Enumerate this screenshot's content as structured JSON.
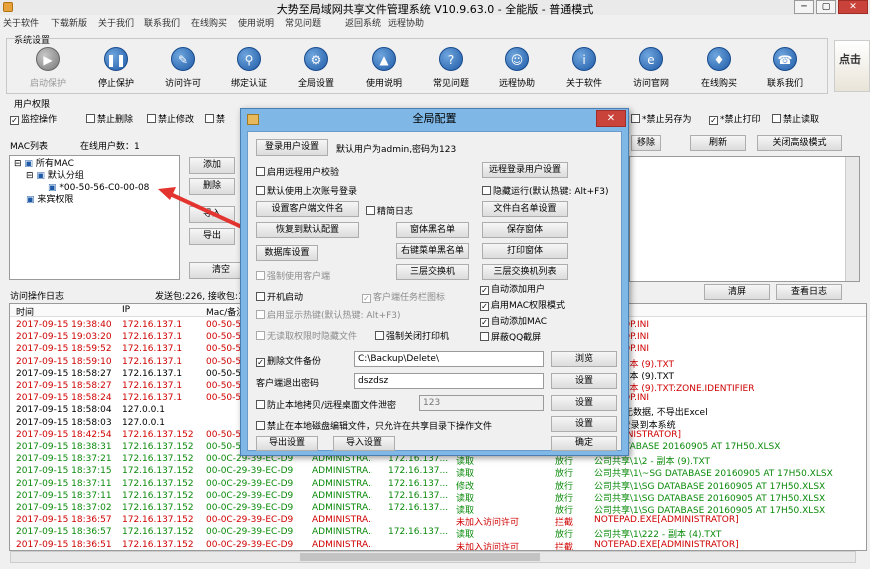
{
  "window": {
    "title": "大势至局域网共享文件管理系统 V10.9.63.0 - 全能版 - 普通模式",
    "min": "─",
    "max": "▢",
    "close": "✕"
  },
  "menu": [
    "关于软件",
    "下载新版",
    "关于我们",
    "联系我们",
    "在线购买",
    "使用说明",
    "常见问题",
    "返回系统",
    "远程协助"
  ],
  "system_settings": {
    "label": "系统设置",
    "buttons": [
      {
        "label": "启动保护",
        "icon": "play-icon",
        "glyph": "▶",
        "disabled": true
      },
      {
        "label": "停止保护",
        "icon": "pause-icon",
        "glyph": "❚❚",
        "disabled": false
      },
      {
        "label": "访问许可",
        "icon": "compass-icon",
        "glyph": "✎",
        "disabled": false
      },
      {
        "label": "绑定认证",
        "icon": "link-icon",
        "glyph": "⚲",
        "disabled": false
      },
      {
        "label": "全局设置",
        "icon": "gear-icon",
        "glyph": "⚙",
        "disabled": false
      },
      {
        "label": "使用说明",
        "icon": "graduation-cap-icon",
        "glyph": "▲",
        "disabled": false
      },
      {
        "label": "常见问题",
        "icon": "question-icon",
        "glyph": "?",
        "disabled": false
      },
      {
        "label": "远程协助",
        "icon": "support-icon",
        "glyph": "☺",
        "disabled": false
      },
      {
        "label": "关于软件",
        "icon": "info-icon",
        "glyph": "i",
        "disabled": false
      },
      {
        "label": "访问官网",
        "icon": "browser-icon",
        "glyph": "e",
        "disabled": false
      },
      {
        "label": "在线购买",
        "icon": "cart-icon",
        "glyph": "♦",
        "disabled": false
      },
      {
        "label": "联系我们",
        "icon": "phone-icon",
        "glyph": "☎",
        "disabled": false
      }
    ],
    "logo_text": "点击"
  },
  "user_permissions": {
    "label": "用户权限",
    "checks": [
      {
        "label": "监控操作",
        "checked": true
      },
      {
        "label": "禁止删除",
        "checked": false
      },
      {
        "label": "禁止修改",
        "checked": false
      },
      {
        "label": "禁",
        "checked": false
      },
      {
        "label": "*禁止另存为",
        "checked": false
      },
      {
        "label": "*禁止打印",
        "checked": true
      },
      {
        "label": "禁止读取",
        "checked": false
      }
    ]
  },
  "mac_list": {
    "label": "MAC列表",
    "online_users": "在线用户数：1",
    "tree": [
      "所有MAC",
      "默认分组",
      "*00-50-56-C0-00-08",
      "来宾权限"
    ],
    "side_buttons": [
      "添加",
      "删除",
      "导入",
      "导出",
      "清空"
    ],
    "top_right_buttons": [
      "移除",
      "刷新",
      "关闭高级模式"
    ]
  },
  "access_log": {
    "label": "访问操作日志",
    "stats": "发送包:226, 接收包:1",
    "clear_button": "清屏",
    "view_log_button": "查看日志",
    "columns": [
      "时间",
      "IP",
      "Mac/备注"
    ],
    "rows": [
      {
        "color": "red",
        "time": "2017-09-15 19:38:40",
        "ip": "172.16.137.1",
        "mac": "00-50-56",
        "tail": "DESKTOP.INI"
      },
      {
        "color": "red",
        "time": "2017-09-15 19:03:20",
        "ip": "172.16.137.1",
        "mac": "00-50-56",
        "tail": "DESKTOP.INI"
      },
      {
        "color": "red",
        "time": "2017-09-15 18:59:52",
        "ip": "172.16.137.1",
        "mac": "00-50-56",
        "tail": "DESKTOP.INI"
      },
      {
        "color": "red",
        "time": "2017-09-15 18:59:10",
        "ip": "172.16.137.1",
        "mac": "00-50-56",
        "tail": "\\1\\2 - 副本 (9).TXT"
      },
      {
        "color": "black",
        "time": "2017-09-15 18:58:27",
        "ip": "172.16.137.1",
        "mac": "00-50-56",
        "tail": "\\1\\2 - 副本 (9).TXT"
      },
      {
        "color": "red",
        "time": "2017-09-15 18:58:27",
        "ip": "172.16.137.1",
        "mac": "00-50-56",
        "tail": "\\1\\2 - 副本 (9).TXT:ZONE.IDENTIFIER"
      },
      {
        "color": "red",
        "time": "2017-09-15 18:58:24",
        "ip": "172.16.137.1",
        "mac": "00-50-56",
        "tail": "DESKTOP.INI"
      },
      {
        "color": "black",
        "time": "2017-09-15 18:58:04",
        "ip": "127.0.0.1",
        "mac": "",
        "tail": "数据库/无数据, 不导出Excel"
      },
      {
        "color": "black",
        "time": "2017-09-15 18:58:03",
        "ip": "127.0.0.1",
        "mac": "",
        "tail": "DMIN]登录到本系统"
      },
      {
        "color": "red",
        "time": "2017-09-15 18:42:54",
        "ip": "172.16.137.152",
        "mac": "00-50-56",
        "tail": "E[ADMINISTRATOR]"
      },
      {
        "color": "green",
        "time": "2017-09-15 18:38:31",
        "ip": "172.16.137.152",
        "mac": "00-50-56",
        "tail": "\\SG DATABASE 20160905 AT 17H50.XLSX"
      },
      {
        "color": "green",
        "time": "2017-09-15 18:37:21",
        "ip": "172.16.137.152",
        "mac": "00-0C-29-39-EC-D9",
        "user": "ADMINISTRA...",
        "ip2": "172.16.137...",
        "op": "读取",
        "act": "放行",
        "tail": "公司共享\\1\\2 - 副本 (9).TXT"
      },
      {
        "color": "green",
        "time": "2017-09-15 18:37:15",
        "ip": "172.16.137.152",
        "mac": "00-0C-29-39-EC-D9",
        "user": "ADMINISTRA...",
        "ip2": "172.16.137...",
        "op": "读取",
        "act": "放行",
        "tail": "公司共享\\1\\~SG DATABASE 20160905 AT 17H50.XLSX"
      },
      {
        "color": "green",
        "time": "2017-09-15 18:37:11",
        "ip": "172.16.137.152",
        "mac": "00-0C-29-39-EC-D9",
        "user": "ADMINISTRA...",
        "ip2": "172.16.137...",
        "op": "修改",
        "act": "放行",
        "tail": "公司共享\\1\\SG DATABASE 20160905 AT 17H50.XLSX"
      },
      {
        "color": "green",
        "time": "2017-09-15 18:37:11",
        "ip": "172.16.137.152",
        "mac": "00-0C-29-39-EC-D9",
        "user": "ADMINISTRA...",
        "ip2": "172.16.137...",
        "op": "读取",
        "act": "放行",
        "tail": "公司共享\\1\\SG DATABASE 20160905 AT 17H50.XLSX"
      },
      {
        "color": "green",
        "time": "2017-09-15 18:37:02",
        "ip": "172.16.137.152",
        "mac": "00-0C-29-39-EC-D9",
        "user": "ADMINISTRA...",
        "ip2": "172.16.137...",
        "op": "读取",
        "act": "放行",
        "tail": "公司共享\\1\\SG DATABASE 20160905 AT 17H50.XLSX"
      },
      {
        "color": "red",
        "time": "2017-09-15 18:36:57",
        "ip": "172.16.137.152",
        "mac": "00-0C-29-39-EC-D9",
        "user": "ADMINISTRA...",
        "ip2": "",
        "op": "未加入访问许可",
        "act": "拦截",
        "tail": "NOTEPAD.EXE[ADMINISTRATOR]"
      },
      {
        "color": "green",
        "time": "2017-09-15 18:36:57",
        "ip": "172.16.137.152",
        "mac": "00-0C-29-39-EC-D9",
        "user": "ADMINISTRA...",
        "ip2": "172.16.137...",
        "op": "读取",
        "act": "放行",
        "tail": "公司共享\\1\\222 - 副本 (4).TXT"
      },
      {
        "color": "red",
        "time": "2017-09-15 18:36:51",
        "ip": "172.16.137.152",
        "mac": "00-0C-29-39-EC-D9",
        "user": "ADMINISTRA...",
        "ip2": "",
        "op": "未加入访问许可",
        "act": "拦截",
        "tail": "NOTEPAD.EXE[ADMINISTRATOR]"
      }
    ]
  },
  "dialog": {
    "title": "全局配置",
    "login_settings_button": "登录用户设置",
    "login_default": "默认用户为admin,密码为123",
    "enable_remote_login": "启用远程用户校验",
    "remote_login_settings": "远程登录用户设置",
    "default_last_account": "默认使用上次账号登录",
    "hide_run": "隐藏运行(默认热键: Alt+F3)",
    "client_name_button": "设置客户端文件名",
    "precise_log": "精简日志",
    "file_whitelist": "文件白名单设置",
    "restore_default": "恢复到默认配置",
    "window_blacklist": "窗体黑名单",
    "save_window": "保存窗体",
    "db_settings": "数据库设置",
    "right_menu_blacklist": "右键菜单黑名单",
    "print_window": "打印窗体",
    "force_client": "强制使用客户端",
    "layer3_switch": "三层交换机",
    "layer3_switch_list": "三层交换机列表",
    "auto_add_user": "自动添加用户",
    "boot_start": "开机启动",
    "client_tray_icon": "客户端任务栏图标",
    "enable_mac_mode": "启用MAC权限模式",
    "hotkey_display": "启用显示热键(默认热键: Alt+F3)",
    "auto_add_mac": "自动添加MAC",
    "no_perm_hide": "无读取权限时隐藏文件",
    "force_close_printer": "强制关闭打印机",
    "block_qq_screenshot": "屏蔽QQ截屏",
    "delete_backup": "删除文件备份",
    "backup_path": "C:\\Backup\\Delete\\",
    "browse": "浏览",
    "exit_pwd_label": "客户端退出密码",
    "exit_pwd_value": "dszdsz",
    "pwd_settings": "设置",
    "prevent_copy": "防止本地拷贝/远程桌面文件泄密",
    "copy_value": "123",
    "copy_settings": "设置",
    "forbid_local_edit": "禁止在本地磁盘编辑文件，只允许在共享目录下操作文件",
    "edit_settings": "设置",
    "export_settings": "导出设置",
    "import_settings": "导入设置",
    "ok": "确定"
  }
}
